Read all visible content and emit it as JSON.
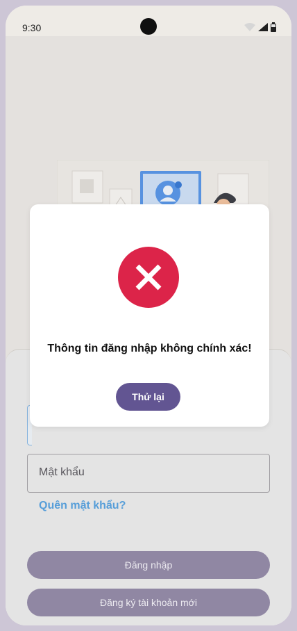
{
  "status_bar": {
    "time": "9:30",
    "icons": [
      "wifi-icon",
      "signal-icon",
      "battery-icon"
    ]
  },
  "form": {
    "password_placeholder": "Mật khẩu",
    "forgot_password": "Quên mật khẩu?",
    "login_label": "Đăng nhập",
    "register_label": "Đăng ký tài khoản mới"
  },
  "dialog": {
    "icon": "error-x-icon",
    "message": "Thông tin đăng nhập không chính xác!",
    "retry_label": "Thử lại"
  },
  "colors": {
    "error": "#dc2449",
    "primary": "#625592",
    "button_disabled": "#958ca9",
    "link": "#5aa4e0"
  }
}
